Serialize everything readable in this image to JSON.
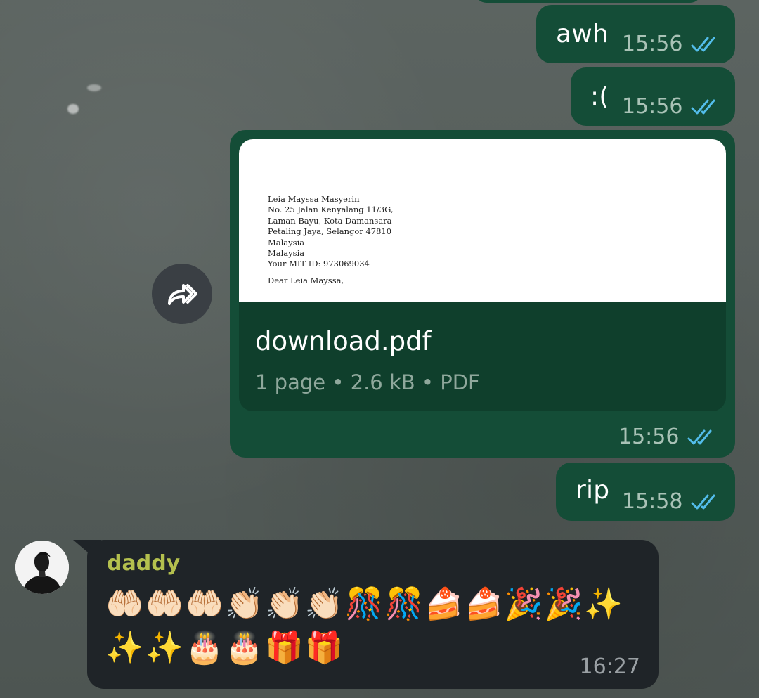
{
  "messages_out": [
    {
      "id": "awh",
      "text": "awh",
      "time": "15:56",
      "status_icon": "double-check-icon"
    },
    {
      "id": "sad",
      "text": ":(",
      "time": "15:56",
      "status_icon": "double-check-icon"
    },
    {
      "id": "doc",
      "time": "15:56",
      "status_icon": "double-check-icon"
    },
    {
      "id": "rip",
      "text": "rip",
      "time": "15:58",
      "status_icon": "double-check-icon"
    }
  ],
  "document": {
    "file_name": "download.pdf",
    "info": "1 page • 2.6 kB • PDF",
    "preview_lines": [
      "Leia Mayssa Masyerin",
      "No. 25 Jalan Kenyalang 11/3G,",
      "Laman Bayu, Kota Damansara",
      "Petaling Jaya, Selangor 47810",
      "Malaysia",
      "Malaysia",
      "Your MIT ID: 973069034",
      "Dear Leia Mayssa,"
    ]
  },
  "message_in": {
    "sender": "daddy",
    "emoji_line_1": "🤲🏻🤲🏻🤲🏻👏🏻👏🏻👏🏻🎊🎊🍰🍰🎉🎉✨",
    "emoji_line_2": "✨✨🎂🎂🎁🎁",
    "time": "16:27"
  },
  "colors": {
    "outgoing_bubble": "#144d37",
    "incoming_bubble": "#1f2428",
    "read_ticks": "#53bdeb",
    "sender_name": "#b4c04e"
  }
}
